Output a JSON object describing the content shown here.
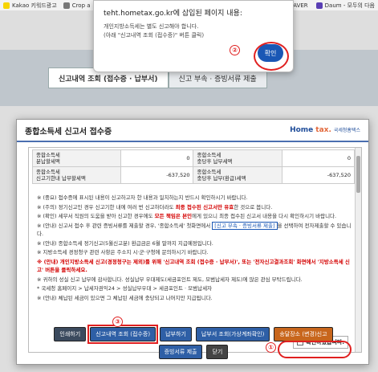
{
  "bookmarks": {
    "items": [
      "Kakao 키워드광고",
      "Crop a"
    ],
    "right_items": [
      "NAVER",
      "Daum - 모두의 다음"
    ]
  },
  "page": {
    "tabs": [
      "신고내역 조회 (접수증 · 납부서)",
      "신고 부속 · 증빙서류 제출"
    ]
  },
  "alert": {
    "title": "teht.hometax.go.kr에 삽입된 페이지 내용:",
    "line1": "개인지방소득세는 별도 신고해야 합니다.",
    "line2": "(아래 \"신고내역 조회 (접수증)\" 버튼 클릭)",
    "ok_label": "확인"
  },
  "callouts": {
    "one": "①",
    "two": "②",
    "three": "③"
  },
  "modal": {
    "title": "종합소득세 신고서 접수증",
    "logo": {
      "home": "Home",
      "tax": "tax.",
      "kor": "국세청홈택스"
    },
    "summary": [
      {
        "label": "종합소득세\n분납할세액",
        "value": "0",
        "label2": "종합소득세\n충당후 납부세액",
        "value2": "0"
      },
      {
        "label": "종합소득세\n신고기한내 납부할세액",
        "value": "-637,520",
        "label2": "종합소득세\n충당후 납부(환급)세액",
        "value2": "-637,520"
      }
    ],
    "notes": {
      "n1": "※ (중요) 접수증에 표시된 내용이 신고하고자 한 내용과 일치하는지 반드시 확인하시기 바랍니다.",
      "n2a": "※ (주의) 정기신고인 경우 신고기한 내에 여러 번 신고하더라도 ",
      "n2b": "최종 접수된 신고서만 유효",
      "n2c": "한 것으로 봅니다.",
      "n3a": "※ (확인) 세무서 직원의 도움을 받아 신고한 경우에도 ",
      "n3b": "모든 책임은 본인",
      "n3c": "에게 있으니 최종 접수된 신고서 내용을 다시 확인하시기 바랍니다.",
      "n4a": "※ (안내) 신고서 접수 후 관련 증빙서류를 제출할 경우, '종합소득세' 첫화면에서 ",
      "n4b": "[신고 부속 · 증빙서류 제출]",
      "n4c": "을 선택하여 전자제출할 수 있습니다.",
      "n5": "※ (안내) 종합소득세 정기신고(5월신고분) 환급금은 6월 말까지 지급예정입니다.",
      "n6": "※ 지방소득세 경정청구 관련 사항은 주소지 시·군·구청에 문의하시기 바랍니다.",
      "n7": "※ (안내) 개인지방소득세 신고(경정청구는 제외)를 위해 '신고내역 조회 (접수증 · 납부서)', 또는 '전자신고결과조회' 화면에서 '지방소득세 신고' 버튼을 클릭하세요.",
      "n8": "※ 귀하의 성실 신고 납부에 감사합니다. 성실납부 우대제도(세금포인트 제도, 모범납세자 제도)에 많은 관심 부탁드립니다.",
      "n9": "  * 국세청 홈페이지 > 납세자권익24 > 성실납부우대 > 세금포인트 · 모범납세자",
      "n10": "※ (안내) 체납된 세금이 있으면 그 체납된 세금에 충당되고 나머지만 지급됩니다."
    },
    "confirm_label": "확인하였습니다.",
    "buttons": [
      {
        "id": "print",
        "label": "인쇄하기"
      },
      {
        "id": "history",
        "label": "신고내역 조회 (접수증)"
      },
      {
        "id": "pay",
        "label": "납부하기"
      },
      {
        "id": "payslip",
        "label": "납부서 조회(가상계좌확인)"
      },
      {
        "id": "agency",
        "label": "송달장소 (변경)신고"
      },
      {
        "id": "docs",
        "label": "증빙서류 제출"
      },
      {
        "id": "close",
        "label": "닫기"
      }
    ]
  }
}
